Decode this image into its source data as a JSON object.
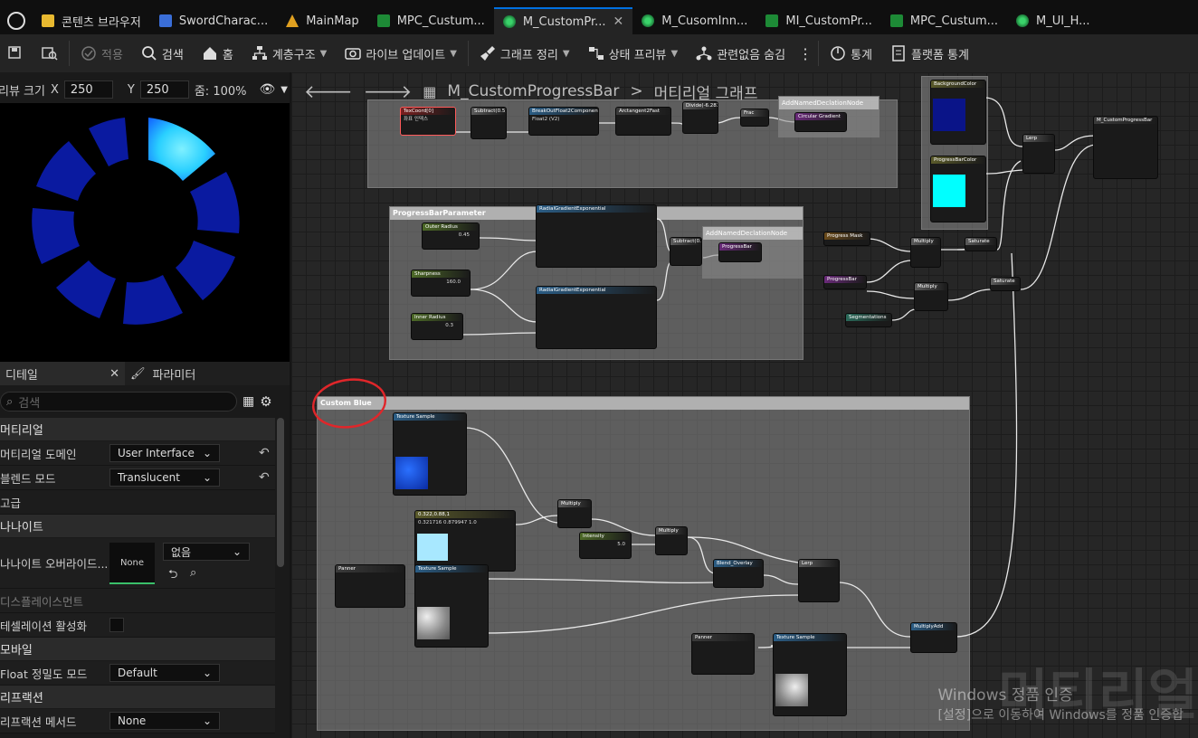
{
  "tabs": [
    {
      "label": "콘텐츠 브라우저",
      "icon": "content-browser-icon"
    },
    {
      "label": "SwordCharac...",
      "icon": "blueprint-icon"
    },
    {
      "label": "MainMap",
      "icon": "level-icon"
    },
    {
      "label": "MPC_Custum...",
      "icon": "mpc-icon"
    },
    {
      "label": "M_CustomPr...",
      "icon": "material-icon",
      "active": true
    },
    {
      "label": "M_CusomInn...",
      "icon": "material-icon"
    },
    {
      "label": "MI_CustomPr...",
      "icon": "material-instance-icon"
    },
    {
      "label": "MPC_Custum...",
      "icon": "mpc-icon"
    },
    {
      "label": "M_UI_H...",
      "icon": "material-icon"
    }
  ],
  "toolbar": {
    "apply": "적용",
    "search": "검색",
    "home": "홈",
    "hierarchy": "계층구조",
    "live_update": "라이브 업데이트",
    "clean_graph": "그래프 정리",
    "state_preview": "상태 프리뷰",
    "hide_unrelated": "관련없음 숨김",
    "stats": "통계",
    "platform_stats": "플랫폼 통계"
  },
  "preview": {
    "size_label": "리뷰 크기",
    "x_label": "X",
    "x_value": "250",
    "y_label": "Y",
    "y_value": "250",
    "zoom": "줌: 100%"
  },
  "details": {
    "tab_details": "디테일",
    "tab_params": "파라미터",
    "search_placeholder": "검색",
    "cat_material": "머티리얼",
    "domain_label": "머티리얼 도메인",
    "domain_value": "User Interface",
    "blend_label": "블렌드 모드",
    "blend_value": "Translucent",
    "cat_advanced": "고급",
    "cat_nanite": "나나이트",
    "nanite_override_label": "나나이트 오버라이드...",
    "nanite_none": "None",
    "nanite_combo": "없음",
    "displacement_label": "디스플레이스먼트",
    "tess_label": "테셀레이션 활성화",
    "cat_mobile": "모바일",
    "float_label": "Float 정밀도 모드",
    "float_value": "Default",
    "cat_reflection": "리프랙션",
    "refraction_label": "리프랙션 메서드",
    "refraction_value": "None"
  },
  "graph": {
    "breadcrumb_asset": "M_CustomProgressBar",
    "breadcrumb_sep": ">",
    "breadcrumb_graph": "머티리얼 그래프",
    "comments": {
      "progress_param": "ProgressBarParameter",
      "custom_blue": "Custom Blue"
    },
    "nodes": {
      "texcoord": "TexCoord[0]",
      "texcoord_val": "좌표 인덱스",
      "subtract": "Subtract(0.5)",
      "breakout": "BreakOutFloat2Components",
      "float2": "Float2 (V2)",
      "arctan": "Arctangent2Fast",
      "divide": "Divide(-6.283)",
      "frac": "Frac",
      "circular": "Circular Gradient",
      "named_decl": "AddNamedDeclationNode",
      "radial1": "RadialGradientExponential",
      "radial2": "RadialGradientExponential",
      "outer_radius": "Outer Radius",
      "outer_val": "0.45",
      "sharpness": "Sharpness",
      "sharp_val": "160.0",
      "inner_radius": "Inner Radius",
      "inner_val": "0.3",
      "progressbar_decl": "ProgressBar",
      "progress_mask": "Progress Mask",
      "progressbar": "ProgressBar",
      "segmentations": "Segmentations",
      "multiply": "Multiply",
      "saturate": "Saturate",
      "lerp": "Lerp",
      "result": "M_CustomProgressBar",
      "bg_color": "BackgroundColor",
      "progress_color": "ProgressBarColor",
      "tex_sample": "Texture Sample",
      "constant": "0.322,0.88,1",
      "intensity": "Intensity",
      "intensity_val": "5.0",
      "panner": "Panner",
      "blend_overlay": "Blend_Overlay",
      "multiply_add": "MultiplyAdd",
      "const_values": "0.321716 0.879947 1.0"
    }
  },
  "watermark": {
    "line1": "Windows 정품 인증",
    "line2": "[설정]으로 이동하여 Windows를 정품 인증합",
    "big": "머티리얼"
  },
  "colors": {
    "accent": "#0070e0",
    "red_circle": "#e0262a",
    "cyan": "#00ffff",
    "navy": "#0a1488"
  }
}
